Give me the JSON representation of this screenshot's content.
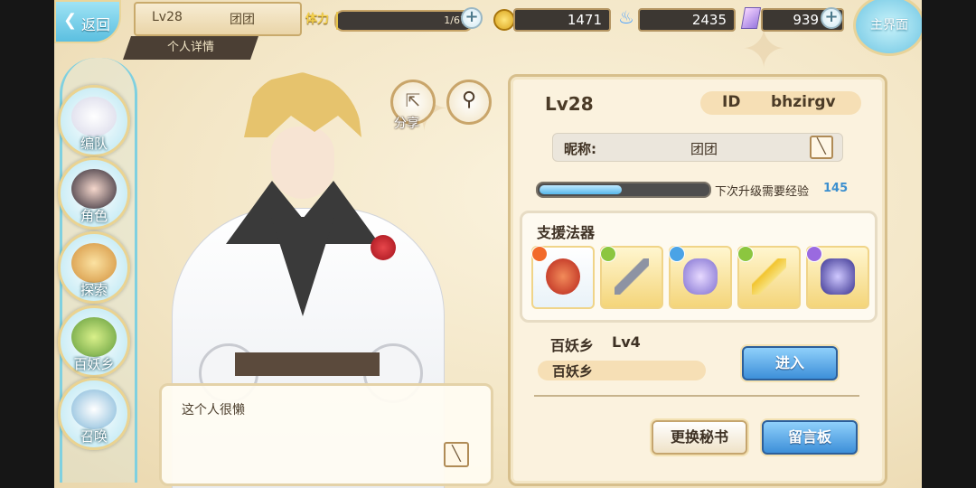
{
  "top_bar": {
    "back_label": "返回",
    "player_level": "Lv28",
    "player_name": "团团",
    "detail_tab": "个人详情",
    "stamina_label": "体力",
    "stamina_value": "1/67",
    "stamina_fraction": 0.015,
    "coins": "1471",
    "souls": "2435",
    "gems": "939",
    "home_label": "主界面"
  },
  "nav": {
    "items": [
      {
        "label": "编队",
        "icon": "team-icon"
      },
      {
        "label": "角色",
        "icon": "character-icon"
      },
      {
        "label": "探索",
        "icon": "explore-icon"
      },
      {
        "label": "百妖乡",
        "icon": "village-icon"
      },
      {
        "label": "召唤",
        "icon": "summon-icon"
      }
    ]
  },
  "actions": {
    "share_label": "分享"
  },
  "bio": {
    "text": "这个人很懒"
  },
  "profile": {
    "level": "Lv28",
    "id_label": "ID",
    "id_value": "bhzirgv",
    "nickname_label": "昵称:",
    "nickname": "团团",
    "exp_fraction": 0.48,
    "exp_text": "下次升级需要经验",
    "exp_value": "145",
    "artifacts_title": "支援法器",
    "artifacts": [
      {
        "icon": "red-orb-artifact-icon",
        "element_color": "#f26a2a"
      },
      {
        "icon": "crossbow-artifact-icon",
        "element_color": "#8cc63f"
      },
      {
        "icon": "serpent-sword-artifact-icon",
        "element_color": "#4aa3e6"
      },
      {
        "icon": "golden-blade-artifact-icon",
        "element_color": "#8cc63f"
      },
      {
        "icon": "dark-sword-artifact-icon",
        "element_color": "#9a6ae0"
      }
    ],
    "village_title": "百妖乡",
    "village_level": "Lv4",
    "village_name": "百妖乡",
    "enter_label": "进入",
    "secretary_label": "更换秘书",
    "message_label": "留言板"
  }
}
